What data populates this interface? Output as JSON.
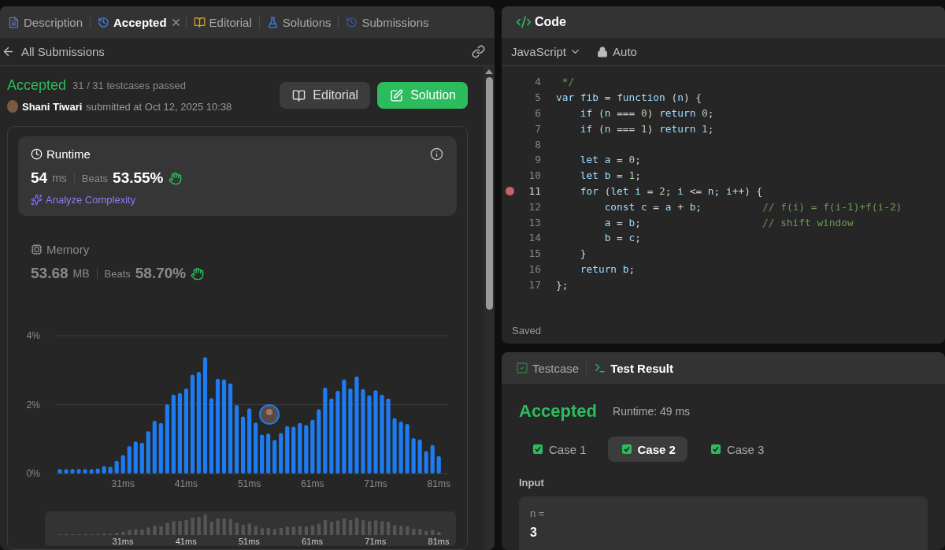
{
  "left_panel": {
    "tabs": [
      {
        "label": "Description",
        "selected": false,
        "closable": false
      },
      {
        "label": "Accepted",
        "selected": true,
        "closable": true
      },
      {
        "label": "Editorial",
        "selected": false,
        "closable": false
      },
      {
        "label": "Solutions",
        "selected": false,
        "closable": false
      },
      {
        "label": "Submissions",
        "selected": false,
        "closable": false
      }
    ],
    "back_link": "All Submissions",
    "submission": {
      "status": "Accepted",
      "testcases": "31 / 31 testcases passed",
      "user": "Shani Tiwari",
      "submitted": "submitted at Oct 12, 2025 10:38"
    },
    "buttons": [
      {
        "label": "Editorial",
        "kind": "secondary"
      },
      {
        "label": "Solution",
        "kind": "primary"
      }
    ],
    "metrics": [
      {
        "kind": "runtime",
        "title": "Runtime",
        "value": "54",
        "unit": "ms",
        "beats_label": "Beats",
        "beats": "53.55%",
        "link": "Analyze Complexity",
        "selected": true
      },
      {
        "kind": "memory",
        "title": "Memory",
        "value": "53.68",
        "unit": "MB",
        "beats_label": "Beats",
        "beats": "58.70%",
        "selected": false
      }
    ],
    "chart_data": {
      "type": "bar",
      "x": [
        21,
        22,
        23,
        24,
        25,
        26,
        27,
        28,
        29,
        30,
        31,
        32,
        33,
        34,
        35,
        36,
        37,
        38,
        39,
        40,
        41,
        42,
        43,
        44,
        45,
        46,
        47,
        48,
        49,
        50,
        51,
        52,
        53,
        54,
        55,
        56,
        57,
        58,
        59,
        60,
        61,
        62,
        63,
        64,
        65,
        66,
        67,
        68,
        69,
        70,
        71,
        72,
        73,
        74,
        75,
        76,
        77,
        78,
        79,
        80,
        81
      ],
      "values": [
        0.13,
        0.13,
        0.13,
        0.13,
        0.13,
        0.13,
        0.15,
        0.22,
        0.2,
        0.37,
        0.54,
        0.8,
        0.93,
        0.9,
        1.23,
        1.53,
        1.47,
        2.01,
        2.29,
        2.34,
        2.47,
        2.87,
        2.95,
        3.38,
        2.19,
        2.75,
        2.73,
        2.62,
        1.99,
        1.66,
        1.89,
        1.48,
        1.13,
        1.16,
        0.98,
        1.18,
        1.38,
        1.36,
        1.47,
        1.41,
        1.56,
        1.87,
        2.5,
        2.18,
        2.4,
        2.73,
        2.47,
        2.82,
        2.45,
        2.27,
        2.42,
        2.29,
        2.18,
        1.61,
        1.51,
        1.44,
        1.03,
        0.99,
        0.65,
        0.83,
        0.51
      ],
      "xlim": [
        20.5,
        81.5
      ],
      "ylim": [
        0,
        4
      ],
      "yticks": [
        {
          "value": 0,
          "label": "0%"
        },
        {
          "value": 2,
          "label": "2%"
        },
        {
          "value": 4,
          "label": "4%"
        }
      ],
      "xticks": [
        {
          "value": 31,
          "label": "31ms"
        },
        {
          "value": 41,
          "label": "41ms"
        },
        {
          "value": 51,
          "label": "51ms"
        },
        {
          "value": 61,
          "label": "61ms"
        },
        {
          "value": 71,
          "label": "71ms"
        },
        {
          "value": 81,
          "label": "81ms"
        }
      ]
    },
    "navigator": {
      "labels": [
        "31ms",
        "41ms",
        "51ms",
        "61ms",
        "71ms",
        "81ms"
      ]
    }
  },
  "editor": {
    "title": "Code",
    "language": "JavaScript",
    "mode": "Auto",
    "status": "Saved",
    "lines": [
      {
        "number": "4",
        "breakpoint": false,
        "comment": " */"
      },
      {
        "number": "5",
        "breakpoint": false,
        "code": "var fib = function (n) {"
      },
      {
        "number": "6",
        "breakpoint": false,
        "code": "    if (n === 0) return 0;"
      },
      {
        "number": "7",
        "breakpoint": false,
        "code": "    if (n === 1) return 1;"
      },
      {
        "number": "8",
        "breakpoint": false
      },
      {
        "number": "9",
        "breakpoint": false,
        "code": "    let a = 0;"
      },
      {
        "number": "10",
        "breakpoint": false,
        "code": "    let b = 1;"
      },
      {
        "number": "11",
        "breakpoint": true,
        "code": "    for (let i = 2; i <= n; i++) {"
      },
      {
        "number": "12",
        "breakpoint": false,
        "code": "        const c = a + b;",
        "comment": "// f(i) = f(i-1)+f(i-2)"
      },
      {
        "number": "13",
        "breakpoint": false,
        "code": "        a = b;",
        "comment": "// shift window"
      },
      {
        "number": "14",
        "breakpoint": false,
        "code": "        b = c;"
      },
      {
        "number": "15",
        "breakpoint": false,
        "code": "    }"
      },
      {
        "number": "16",
        "breakpoint": false,
        "code": "    return b;"
      },
      {
        "number": "17",
        "breakpoint": false,
        "code": "};"
      }
    ]
  },
  "test_panel": {
    "tabs": [
      {
        "label": "Testcase",
        "selected": false
      },
      {
        "label": "Test Result",
        "selected": true
      }
    ],
    "status": "Accepted",
    "runtime": "Runtime: 49 ms",
    "cases": [
      {
        "label": "Case 1",
        "passed": true,
        "selected": false
      },
      {
        "label": "Case 2",
        "passed": true,
        "selected": true
      },
      {
        "label": "Case 3",
        "passed": true,
        "selected": false
      }
    ],
    "input_label": "Input",
    "inputs": [
      {
        "name": "n =",
        "value": "3"
      }
    ]
  }
}
